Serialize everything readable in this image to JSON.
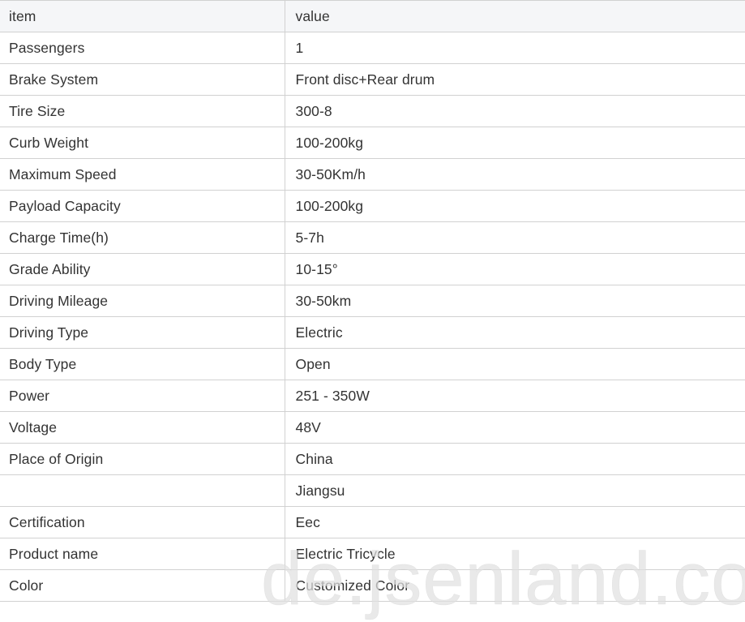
{
  "table": {
    "headers": {
      "item": "item",
      "value": "value"
    },
    "rows": [
      {
        "item": "Passengers",
        "value": "1"
      },
      {
        "item": "Brake System",
        "value": "Front disc+Rear drum"
      },
      {
        "item": "Tire Size",
        "value": "300-8"
      },
      {
        "item": "Curb Weight",
        "value": "100-200kg"
      },
      {
        "item": "Maximum Speed",
        "value": "30-50Km/h"
      },
      {
        "item": "Payload Capacity",
        "value": "100-200kg"
      },
      {
        "item": "Charge Time(h)",
        "value": "5-7h"
      },
      {
        "item": "Grade Ability",
        "value": "10-15°"
      },
      {
        "item": "Driving Mileage",
        "value": "30-50km"
      },
      {
        "item": "Driving Type",
        "value": "Electric"
      },
      {
        "item": "Body Type",
        "value": "Open"
      },
      {
        "item": "Power",
        "value": "251 - 350W"
      },
      {
        "item": "Voltage",
        "value": "48V"
      },
      {
        "item": "Place of Origin",
        "value": "China"
      },
      {
        "item": "",
        "value": "Jiangsu"
      },
      {
        "item": "Certification",
        "value": "Eec"
      },
      {
        "item": "Product name",
        "value": "Electric Tricycle"
      },
      {
        "item": "Color",
        "value": "Customized Color"
      }
    ]
  },
  "watermark": "de.jsenland.com",
  "colors": {
    "header_bg": "#f5f6f8",
    "border": "#d1d1d1",
    "text": "#333333"
  }
}
